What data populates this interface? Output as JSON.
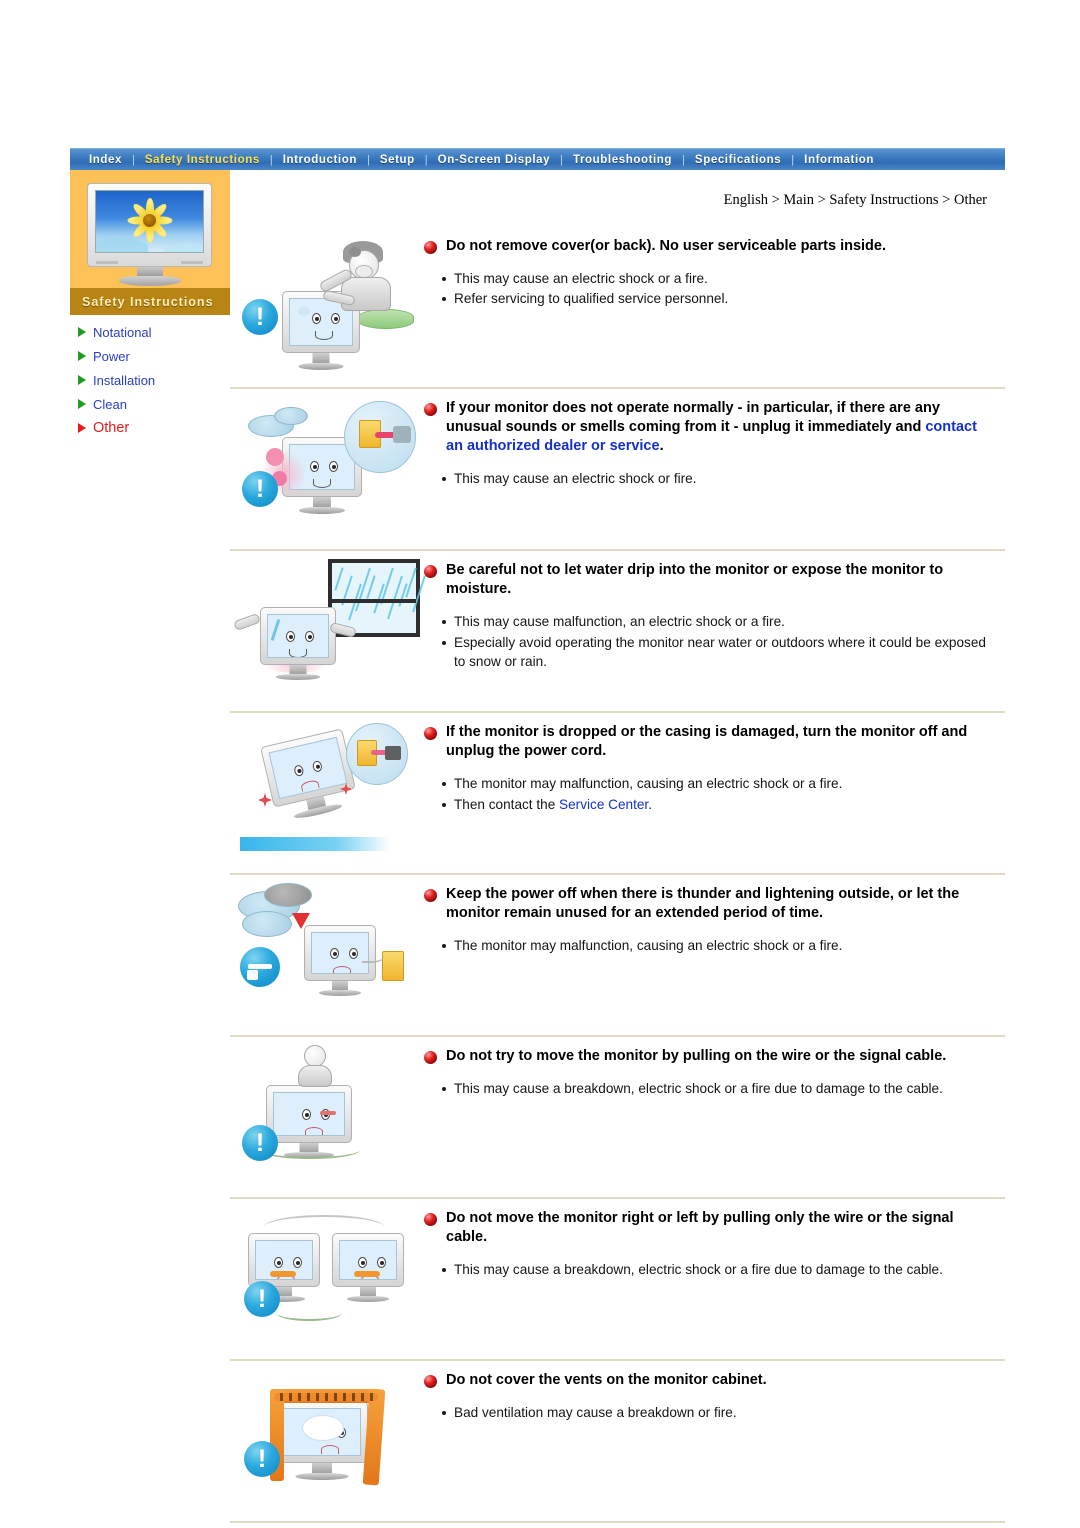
{
  "topnav": {
    "items": [
      {
        "label": "Index",
        "active": false
      },
      {
        "label": "Safety Instructions",
        "active": true
      },
      {
        "label": "Introduction",
        "active": false
      },
      {
        "label": "Setup",
        "active": false
      },
      {
        "label": "On-Screen Display",
        "active": false
      },
      {
        "label": "Troubleshooting",
        "active": false
      },
      {
        "label": "Specifications",
        "active": false
      },
      {
        "label": "Information",
        "active": false
      }
    ],
    "separator": "|"
  },
  "sidebar": {
    "caption": "Safety Instructions",
    "items": [
      {
        "label": "Notational",
        "active": false
      },
      {
        "label": "Power",
        "active": false
      },
      {
        "label": "Installation",
        "active": false
      },
      {
        "label": "Clean",
        "active": false
      },
      {
        "label": "Other",
        "active": true
      }
    ]
  },
  "breadcrumb": "English > Main > Safety Instructions > Other",
  "colors": {
    "nav_active": "#ffe14d",
    "sidebar_bg": "#fcc257",
    "sidebar_caption_bg": "#b88413",
    "link": "#1431d0",
    "active_item": "#e81b1b",
    "divider": "#e0dcc4",
    "warn_badge": "#2aa8dd"
  },
  "sections": [
    {
      "heading_parts": [
        {
          "text": "Do not remove cover(or back). No user serviceable parts inside.",
          "link": false
        }
      ],
      "bullets": [
        "This may cause an electric shock or a fire.",
        "Refer servicing to qualified service personnel."
      ],
      "illustration": "technician-opening-monitor"
    },
    {
      "heading_parts": [
        {
          "text": "If your monitor does not operate normally - in particular, if there are any unusual sounds or smells coming from it - unplug it immediately and ",
          "link": false
        },
        {
          "text": "contact an authorized dealer or service",
          "link": true
        },
        {
          "text": ".",
          "link": false
        }
      ],
      "bullets": [
        "This may cause an electric shock or fire."
      ],
      "illustration": "smoking-monitor-unplug"
    },
    {
      "heading_parts": [
        {
          "text": "Be careful not to let water drip into the monitor or expose the monitor to moisture.",
          "link": false
        }
      ],
      "bullets": [
        "This may cause malfunction, an electric shock or a fire.",
        "Especially avoid operating the monitor near water or outdoors where it could be exposed to snow or rain."
      ],
      "illustration": "monitor-in-rain"
    },
    {
      "heading_parts": [
        {
          "text": "If the monitor is dropped or the casing is damaged, turn the monitor off and unplug the power cord.",
          "link": false
        }
      ],
      "bullets_rich": [
        [
          {
            "text": "The monitor may malfunction, causing an electric shock or a fire.",
            "link": false
          }
        ],
        [
          {
            "text": "Then contact the ",
            "link": false
          },
          {
            "text": "Service Center",
            "link": true
          },
          {
            "text": ".",
            "link": false
          }
        ]
      ],
      "illustration": "dropped-monitor"
    },
    {
      "heading_parts": [
        {
          "text": "Keep the power off when there is thunder and lightening outside, or let the monitor remain unused for an extended period of time.",
          "link": false
        }
      ],
      "bullets": [
        "The monitor may malfunction, causing an electric shock or a fire."
      ],
      "illustration": "thunderstorm-monitor"
    },
    {
      "heading_parts": [
        {
          "text": "Do not try to move the monitor by pulling on the wire or the signal cable.",
          "link": false
        }
      ],
      "bullets": [
        "This may cause a breakdown, electric shock or a fire due to damage to the cable."
      ],
      "illustration": "pulling-monitor-by-cable"
    },
    {
      "heading_parts": [
        {
          "text": "Do not move the monitor right or left by pulling only the wire or the signal cable.",
          "link": false
        }
      ],
      "bullets": [
        "This may cause a breakdown, electric shock or a fire due to damage to the cable."
      ],
      "illustration": "moving-monitor-sideways"
    },
    {
      "heading_parts": [
        {
          "text": "Do not cover the vents on the monitor cabinet.",
          "link": false
        }
      ],
      "bullets": [
        "Bad ventilation may cause a breakdown or fire."
      ],
      "illustration": "covered-vents-monitor"
    }
  ]
}
